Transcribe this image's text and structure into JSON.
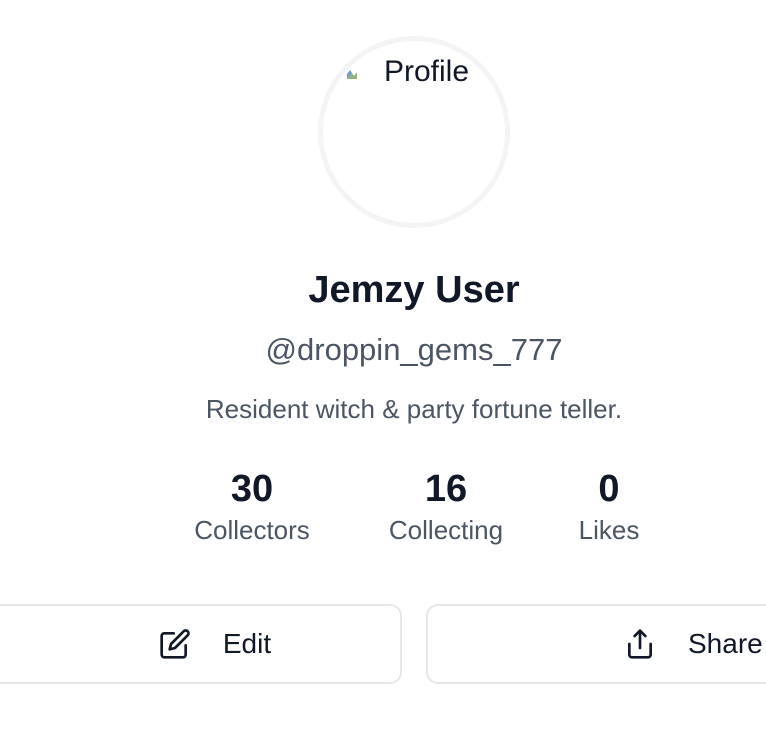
{
  "profile": {
    "avatar_alt": "Profile",
    "name": "Jemzy User",
    "handle": "@droppin_gems_777",
    "bio": "Resident witch & party fortune teller."
  },
  "stats": [
    {
      "value": "30",
      "label": "Collectors"
    },
    {
      "value": "16",
      "label": "Collecting"
    },
    {
      "value": "0",
      "label": "Likes"
    }
  ],
  "actions": {
    "edit_label": "Edit",
    "share_label": "Share"
  },
  "icons": {
    "edit": "edit-pencil-icon",
    "share": "share-upload-icon",
    "broken_image": "broken-image-icon"
  },
  "colors": {
    "text_primary": "#111827",
    "text_secondary": "#4b5563",
    "border": "#e5e7eb",
    "avatar_ring": "#f3f4f6"
  }
}
